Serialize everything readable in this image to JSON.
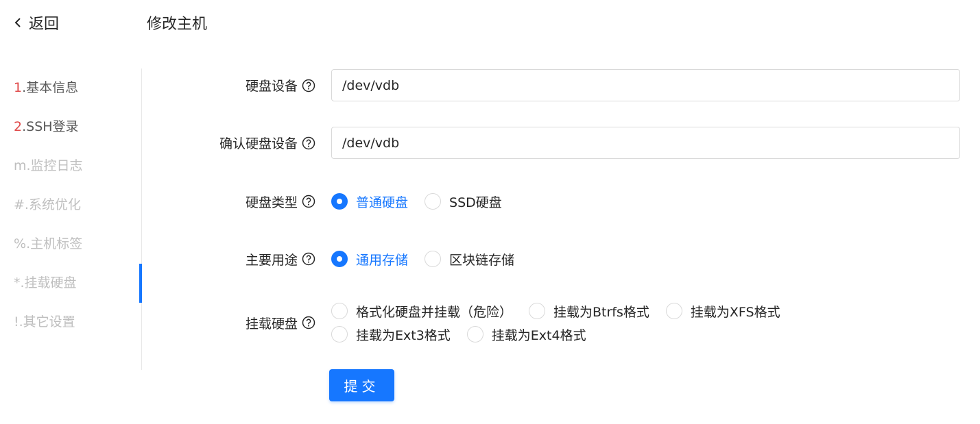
{
  "header": {
    "back_label": "返回",
    "title": "修改主机"
  },
  "steps": [
    {
      "num": "1",
      "label": ".基本信息"
    },
    {
      "num": "2",
      "label": ".SSH登录"
    },
    {
      "num": "m",
      "label": ".监控日志"
    },
    {
      "num": "#",
      "label": ".系统优化"
    },
    {
      "num": "%",
      "label": ".主机标签"
    },
    {
      "num": "*",
      "label": ".挂载硬盘"
    },
    {
      "num": "!",
      "label": ".其它设置"
    }
  ],
  "form": {
    "disk_device": {
      "label": "硬盘设备",
      "value": "/dev/vdb"
    },
    "confirm_disk_device": {
      "label": "确认硬盘设备",
      "value": "/dev/vdb"
    },
    "disk_type": {
      "label": "硬盘类型",
      "options": [
        "普通硬盘",
        "SSD硬盘"
      ],
      "selected": "普通硬盘"
    },
    "usage": {
      "label": "主要用途",
      "options": [
        "通用存储",
        "区块链存储"
      ],
      "selected": "通用存储"
    },
    "mount": {
      "label": "挂载硬盘",
      "options": [
        "格式化硬盘并挂载（危险）",
        "挂载为Btrfs格式",
        "挂载为XFS格式",
        "挂载为Ext3格式",
        "挂载为Ext4格式"
      ],
      "selected": ""
    },
    "submit_label": "提交"
  },
  "colors": {
    "primary": "#1677ff",
    "step_number_done": "#e04a4a",
    "step_pending": "#bfbfbf"
  }
}
